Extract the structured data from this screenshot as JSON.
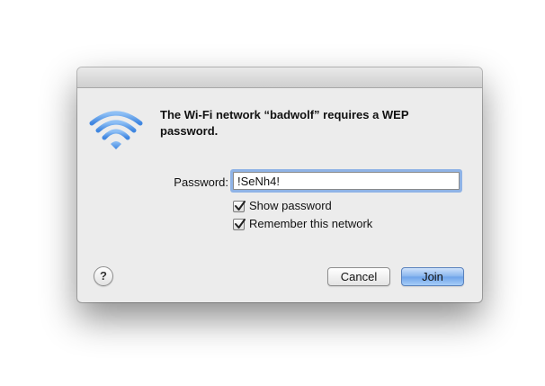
{
  "dialog": {
    "message": "The Wi-Fi network “badwolf” requires a WEP password.",
    "password_label": "Password:",
    "password_value": "!SeNh4!",
    "show_password": {
      "label": "Show password",
      "checked": true
    },
    "remember_network": {
      "label": "Remember this network",
      "checked": true
    },
    "help_label": "?",
    "cancel_label": "Cancel",
    "join_label": "Join"
  },
  "colors": {
    "wifi_icon": "#5b9be8",
    "default_button": "#86b4ee",
    "focus_ring": "#8fb3e6"
  },
  "icons": {
    "network": "wifi-icon",
    "check": "checkmark-icon"
  }
}
